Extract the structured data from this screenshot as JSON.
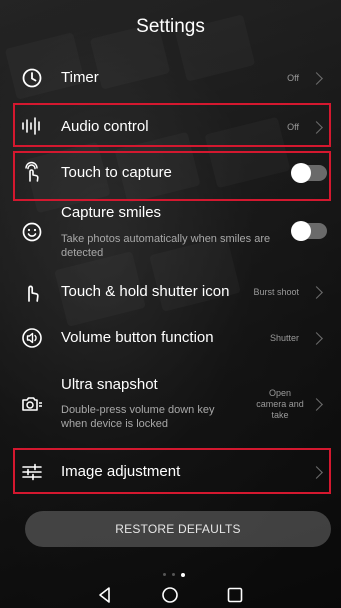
{
  "header": {
    "title": "Settings"
  },
  "rows": [
    {
      "label": "Timer",
      "value": "Off",
      "icon": "clock-icon",
      "highlighted": false
    },
    {
      "label": "Audio control",
      "value": "Off",
      "icon": "audio-wave-icon",
      "highlighted": true
    },
    {
      "label": "Touch to capture",
      "toggle": false,
      "icon": "touch-hand-icon",
      "highlighted": true
    },
    {
      "label": "Capture smiles",
      "sub": "Take photos automatically when smiles are detected",
      "toggle": false,
      "icon": "smile-icon",
      "highlighted": false
    },
    {
      "label": "Touch & hold shutter icon",
      "value": "Burst shoot",
      "icon": "touch-hold-icon",
      "highlighted": false
    },
    {
      "label": "Volume button function",
      "value": "Shutter",
      "icon": "volume-icon",
      "highlighted": false
    },
    {
      "label": "Ultra snapshot",
      "sub": "Double-press volume down key when device is locked",
      "value": "Open camera and take",
      "icon": "ultra-snapshot-icon",
      "highlighted": false
    },
    {
      "label": "Image adjustment",
      "icon": "sliders-icon",
      "highlighted": true
    }
  ],
  "restore_label": "RESTORE DEFAULTS",
  "page_indicator": {
    "count": 3,
    "active": 3
  },
  "navbar": {
    "buttons": [
      "back-icon",
      "home-icon",
      "recents-icon"
    ]
  },
  "colors": {
    "highlight": "#d4182f",
    "toggle_track": "#6a6a6a",
    "text_secondary": "#9a9a9a"
  }
}
